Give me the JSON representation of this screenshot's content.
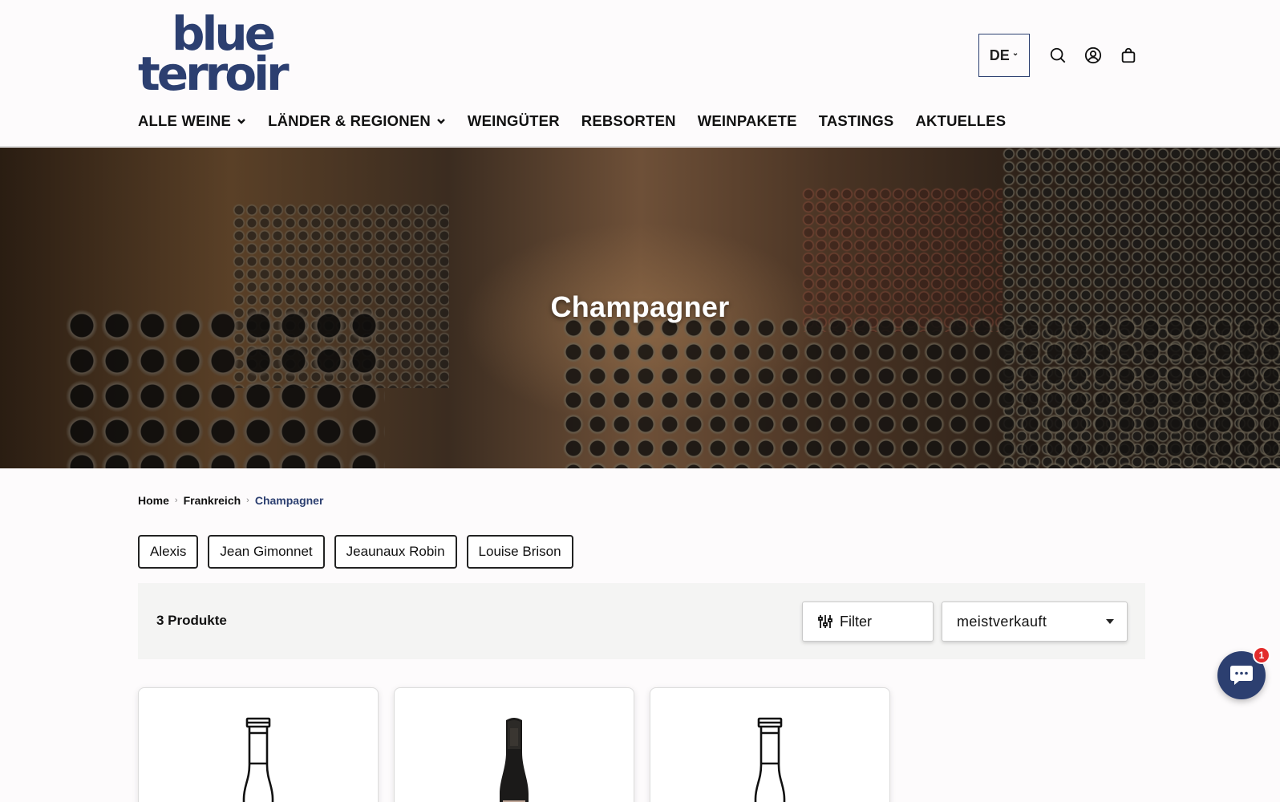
{
  "brand": {
    "line1": "blue",
    "line2": "terroir",
    "color": "#2c3f70"
  },
  "header": {
    "language": "DE",
    "icons": [
      "search-icon",
      "account-icon",
      "cart-icon"
    ]
  },
  "nav": {
    "items": [
      {
        "label": "ALLE WEINE",
        "has_dropdown": true
      },
      {
        "label": "LÄNDER & REGIONEN",
        "has_dropdown": true
      },
      {
        "label": "WEINGÜTER",
        "has_dropdown": false
      },
      {
        "label": "REBSORTEN",
        "has_dropdown": false
      },
      {
        "label": "WEINPAKETE",
        "has_dropdown": false
      },
      {
        "label": "TASTINGS",
        "has_dropdown": false
      },
      {
        "label": "AKTUELLES",
        "has_dropdown": false
      }
    ]
  },
  "hero": {
    "title": "Champagner"
  },
  "breadcrumb": {
    "items": [
      "Home",
      "Frankreich",
      "Champagner"
    ]
  },
  "producers": [
    "Alexis",
    "Jean Gimonnet",
    "Jeaunaux Robin",
    "Louise Brison"
  ],
  "toolbar": {
    "count": "3 Produkte",
    "filter_label": "Filter",
    "sort_value": "meistverkauft"
  },
  "products": [
    {
      "image": "bottle-outline"
    },
    {
      "image": "champagne-bottle-photo"
    },
    {
      "image": "bottle-outline"
    }
  ],
  "chat": {
    "badge": "1"
  }
}
